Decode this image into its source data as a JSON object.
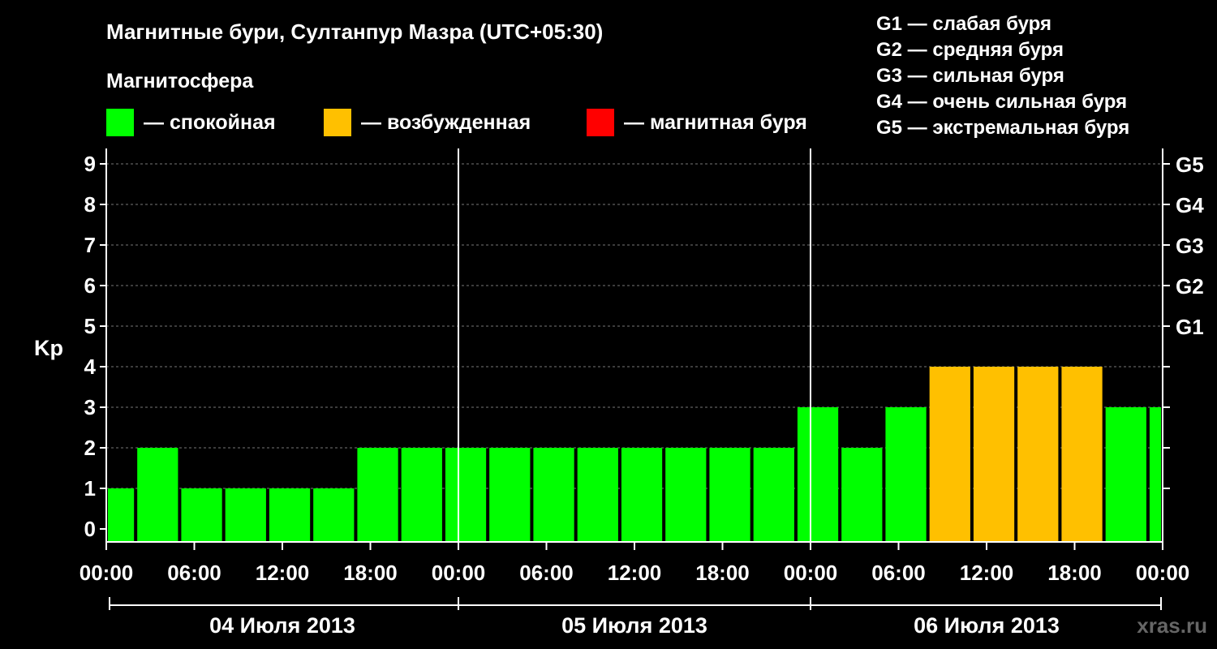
{
  "title": "Магнитные бури, Султанпур Мазра (UTC+05:30)",
  "legend": {
    "title": "Магнитосфера",
    "items": [
      {
        "label": "— спокойная",
        "color": "#00ff00"
      },
      {
        "label": "— возбужденная",
        "color": "#ffc000"
      },
      {
        "label": "— магнитная буря",
        "color": "#ff0000"
      }
    ]
  },
  "g_scale": [
    "G1 — слабая буря",
    "G2 — средняя буря",
    "G3 — сильная буря",
    "G4 — очень сильная буря",
    "G5 — экстремальная буря"
  ],
  "watermark": "xras.ru",
  "chart_data": {
    "type": "bar",
    "ylabel": "Kp",
    "ylim": [
      0,
      9
    ],
    "yticks": [
      0,
      1,
      2,
      3,
      4,
      5,
      6,
      7,
      8,
      9
    ],
    "right_ticks": [
      {
        "value": 5,
        "label": "G1"
      },
      {
        "value": 6,
        "label": "G2"
      },
      {
        "value": 7,
        "label": "G3"
      },
      {
        "value": 8,
        "label": "G4"
      },
      {
        "value": 9,
        "label": "G5"
      }
    ],
    "xlim_hours": [
      0,
      72
    ],
    "x_tick_labels": [
      "00:00",
      "06:00",
      "12:00",
      "18:00",
      "00:00",
      "06:00",
      "12:00",
      "18:00",
      "00:00",
      "06:00",
      "12:00",
      "18:00",
      "00:00"
    ],
    "days": [
      "04 Июля 2013",
      "05 Июля 2013",
      "06 Июля 2013"
    ],
    "bars": [
      {
        "start": 0,
        "end": 2,
        "kp": 1,
        "color": "#00ff00"
      },
      {
        "start": 2,
        "end": 5,
        "kp": 2,
        "color": "#00ff00"
      },
      {
        "start": 5,
        "end": 8,
        "kp": 1,
        "color": "#00ff00"
      },
      {
        "start": 8,
        "end": 11,
        "kp": 1,
        "color": "#00ff00"
      },
      {
        "start": 11,
        "end": 14,
        "kp": 1,
        "color": "#00ff00"
      },
      {
        "start": 14,
        "end": 17,
        "kp": 1,
        "color": "#00ff00"
      },
      {
        "start": 17,
        "end": 20,
        "kp": 2,
        "color": "#00ff00"
      },
      {
        "start": 20,
        "end": 23,
        "kp": 2,
        "color": "#00ff00"
      },
      {
        "start": 23,
        "end": 26,
        "kp": 2,
        "color": "#00ff00"
      },
      {
        "start": 26,
        "end": 29,
        "kp": 2,
        "color": "#00ff00"
      },
      {
        "start": 29,
        "end": 32,
        "kp": 2,
        "color": "#00ff00"
      },
      {
        "start": 32,
        "end": 35,
        "kp": 2,
        "color": "#00ff00"
      },
      {
        "start": 35,
        "end": 38,
        "kp": 2,
        "color": "#00ff00"
      },
      {
        "start": 38,
        "end": 41,
        "kp": 2,
        "color": "#00ff00"
      },
      {
        "start": 41,
        "end": 44,
        "kp": 2,
        "color": "#00ff00"
      },
      {
        "start": 44,
        "end": 47,
        "kp": 2,
        "color": "#00ff00"
      },
      {
        "start": 47,
        "end": 50,
        "kp": 3,
        "color": "#00ff00"
      },
      {
        "start": 50,
        "end": 53,
        "kp": 2,
        "color": "#00ff00"
      },
      {
        "start": 53,
        "end": 56,
        "kp": 3,
        "color": "#00ff00"
      },
      {
        "start": 56,
        "end": 59,
        "kp": 4,
        "color": "#ffc000"
      },
      {
        "start": 59,
        "end": 62,
        "kp": 4,
        "color": "#ffc000"
      },
      {
        "start": 62,
        "end": 65,
        "kp": 4,
        "color": "#ffc000"
      },
      {
        "start": 65,
        "end": 68,
        "kp": 4,
        "color": "#ffc000"
      },
      {
        "start": 68,
        "end": 71,
        "kp": 3,
        "color": "#00ff00"
      },
      {
        "start": 71,
        "end": 72,
        "kp": 3,
        "color": "#00ff00"
      }
    ]
  }
}
